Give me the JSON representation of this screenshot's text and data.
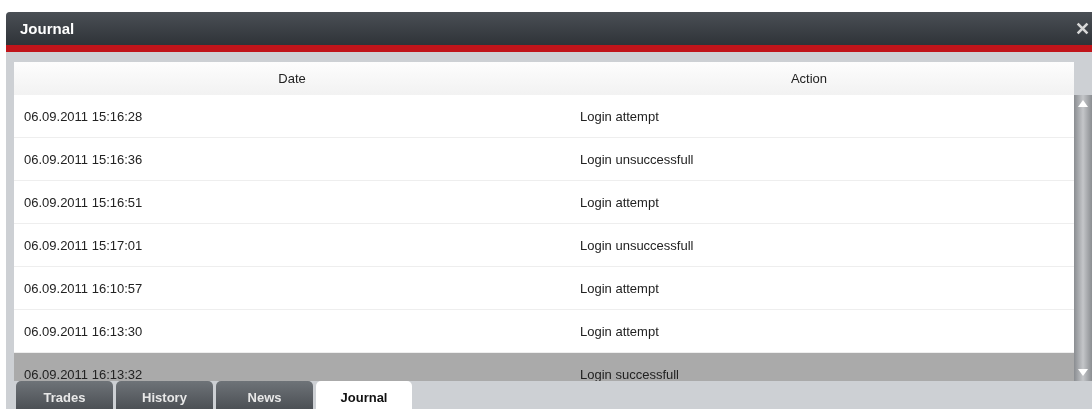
{
  "window": {
    "title": "Journal",
    "close": "✕"
  },
  "table": {
    "columns": [
      "Date",
      "Action"
    ],
    "rows": [
      {
        "date": "06.09.2011 15:16:28",
        "action": "Login attempt",
        "selected": false
      },
      {
        "date": "06.09.2011 15:16:36",
        "action": "Login unsuccessfull",
        "selected": false
      },
      {
        "date": "06.09.2011 15:16:51",
        "action": "Login attempt",
        "selected": false
      },
      {
        "date": "06.09.2011 15:17:01",
        "action": "Login unsuccessfull",
        "selected": false
      },
      {
        "date": "06.09.2011 16:10:57",
        "action": "Login attempt",
        "selected": false
      },
      {
        "date": "06.09.2011 16:13:30",
        "action": "Login attempt",
        "selected": false
      },
      {
        "date": "06.09.2011 16:13:32",
        "action": "Login successfull",
        "selected": true
      }
    ]
  },
  "tabs": [
    {
      "label": "Trades",
      "selected": false
    },
    {
      "label": "History",
      "selected": false
    },
    {
      "label": "News",
      "selected": false
    },
    {
      "label": "Journal",
      "selected": true
    }
  ]
}
